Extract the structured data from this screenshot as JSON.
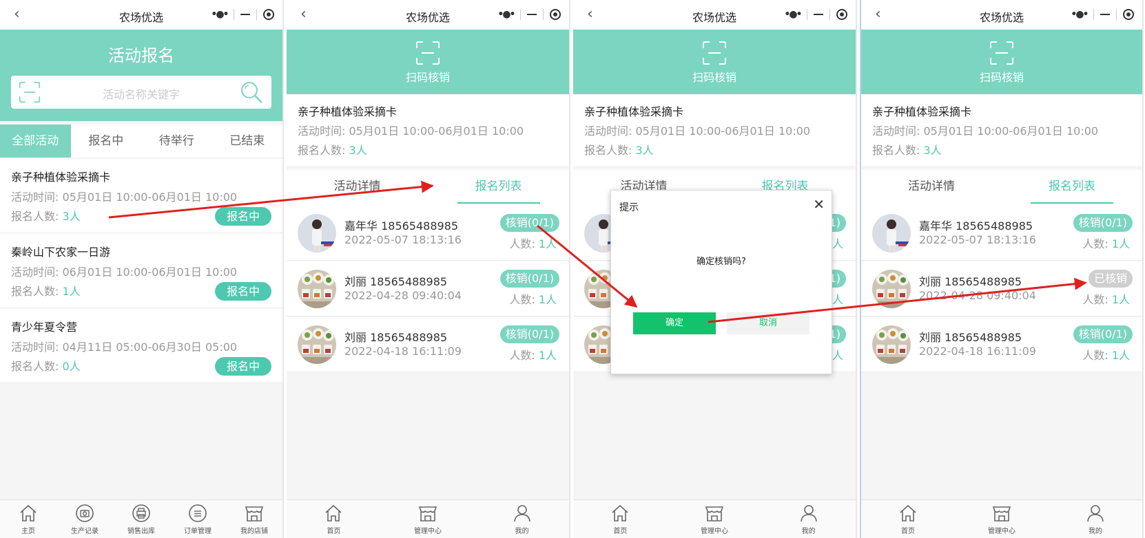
{
  "app_title": "农场优选",
  "colors": {
    "accent": "#7bd5c1",
    "accent_text": "#4fc8b0",
    "confirm": "#12c26c",
    "arrow": "#e02020",
    "disabled": "#cfcfcf"
  },
  "panel1": {
    "header_title": "活动报名",
    "search_placeholder": "活动名称关键字",
    "tabs": [
      "全部活动",
      "报名中",
      "待举行",
      "已结束"
    ],
    "activities": [
      {
        "name": "亲子种植体验采摘卡",
        "time_label": "活动时间:",
        "time": "05月01日 10:00-06月01日 10:00",
        "count_label": "报名人数:",
        "count": "3人",
        "status": "报名中"
      },
      {
        "name": "秦岭山下农家一日游",
        "time_label": "活动时间:",
        "time": "06月01日 10:00-06月01日 10:00",
        "count_label": "报名人数:",
        "count": "1人",
        "status": "报名中"
      },
      {
        "name": "青少年夏令营",
        "time_label": "活动时间:",
        "time": "04月11日 05:00-06月30日 05:00",
        "count_label": "报名人数:",
        "count": "0人",
        "status": "报名中"
      }
    ],
    "nav": [
      "主页",
      "生产记录",
      "销售出库",
      "订单管理",
      "我的店铺"
    ]
  },
  "detail": {
    "scan_label": "扫码核销",
    "activity_name": "亲子种植体验采摘卡",
    "time_label": "活动时间:",
    "time": "05月01日 10:00-06月01日 10:00",
    "count_label": "报名人数:",
    "count": "3人",
    "tabs": [
      "活动详情",
      "报名列表"
    ],
    "registrations": [
      {
        "name": "嘉年华 18565488985",
        "date": "2022-05-07 18:13:16",
        "count_label": "人数:",
        "count": "1人",
        "verify": "核销(0/1)"
      },
      {
        "name": "刘丽 18565488985",
        "date": "2022-04-28 09:40:04",
        "count_label": "人数:",
        "count": "1人",
        "verify": "核销(0/1)"
      },
      {
        "name": "刘丽 18565488985",
        "date": "2022-04-18 16:11:09",
        "count_label": "人数:",
        "count": "1人",
        "verify": "核销(0/1)"
      }
    ],
    "verified_label": "已核销",
    "nav": [
      "首页",
      "管理中心",
      "我的"
    ]
  },
  "dialog": {
    "title": "提示",
    "close": "✕",
    "message": "确定核销吗?",
    "ok": "确定",
    "cancel": "取消"
  }
}
